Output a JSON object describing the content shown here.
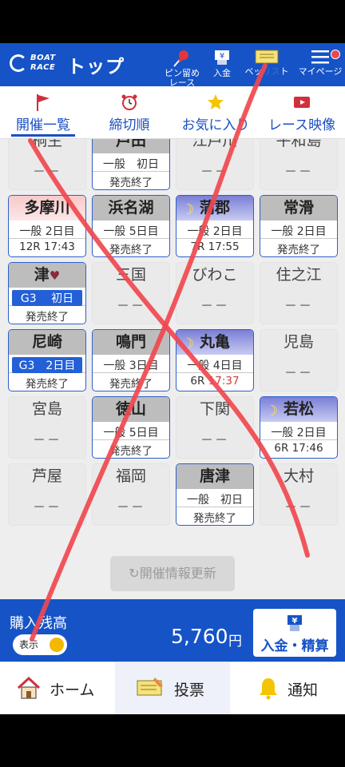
{
  "header": {
    "logo_line1": "BOAT",
    "logo_line2": "RACE",
    "title": "トップ",
    "buttons": [
      {
        "label": "ピン留め\nレース",
        "icon": "pin-icon"
      },
      {
        "label": "入金",
        "icon": "yen-deposit-icon"
      },
      {
        "label": "ベッ",
        "icon": "ticket-icon"
      },
      {
        "label": "ト",
        "icon": ""
      },
      {
        "label": "マイページ",
        "icon": "menu-icon"
      }
    ]
  },
  "tabs": [
    {
      "label": "開催一覧",
      "icon": "flag-icon",
      "active": true
    },
    {
      "label": "締切順",
      "icon": "alarm-clock-icon",
      "active": false
    },
    {
      "label": "お気に入り",
      "icon": "star-icon",
      "active": false
    },
    {
      "label": "レース映像",
      "icon": "video-icon",
      "active": false
    }
  ],
  "venues": [
    {
      "name": "桐生",
      "status": "none"
    },
    {
      "name": "戸田",
      "status": "on",
      "l2": "一般　初日",
      "l3": "発売終了"
    },
    {
      "name": "江戸川",
      "status": "none"
    },
    {
      "name": "平和島",
      "status": "none"
    },
    {
      "name": "多摩川",
      "status": "on",
      "theme": "day",
      "l2": "一般 2日目",
      "race": "12R",
      "time": "17:43"
    },
    {
      "name": "浜名湖",
      "status": "on",
      "l2": "一般 5日目",
      "l3": "発売終了"
    },
    {
      "name": "蒲郡",
      "status": "on",
      "theme": "night",
      "l2": "一般 2日目",
      "race": "7R",
      "time": "17:55"
    },
    {
      "name": "常滑",
      "status": "on",
      "l2": "一般 2日目",
      "l3": "発売終了"
    },
    {
      "name": "津",
      "status": "on",
      "heart": "♥",
      "g3": "G3　 初日",
      "l3": "発売終了"
    },
    {
      "name": "三国",
      "status": "none"
    },
    {
      "name": "びわこ",
      "status": "none"
    },
    {
      "name": "住之江",
      "status": "none"
    },
    {
      "name": "尼崎",
      "status": "on",
      "g3": "G3　2日目",
      "l3": "発売終了"
    },
    {
      "name": "鳴門",
      "status": "on",
      "l2": "一般 3日目",
      "l3": "発売終了"
    },
    {
      "name": "丸亀",
      "status": "on",
      "theme": "night",
      "l2": "一般 4日目",
      "race": "6R",
      "time": "17:37",
      "late": true
    },
    {
      "name": "児島",
      "status": "none"
    },
    {
      "name": "宮島",
      "status": "none"
    },
    {
      "name": "徳山",
      "status": "on",
      "l2": "一般 5日目",
      "l3": "発売終了"
    },
    {
      "name": "下関",
      "status": "none"
    },
    {
      "name": "若松",
      "status": "on",
      "theme": "night",
      "l2": "一般 2日目",
      "race": "6R",
      "time": "17:46"
    },
    {
      "name": "芦屋",
      "status": "none"
    },
    {
      "name": "福岡",
      "status": "none"
    },
    {
      "name": "唐津",
      "status": "on",
      "l2": "一般　初日",
      "l3": "発売終了"
    },
    {
      "name": "大村",
      "status": "none"
    }
  ],
  "none_text": "－－",
  "refresh_label": "開催情報更新",
  "balance": {
    "label": "購入残高",
    "toggle_label": "表示",
    "amount": "5,760",
    "unit": "円",
    "deposit_label": "入金・精算"
  },
  "bottom_nav": [
    {
      "label": "ホーム",
      "icon": "home-icon"
    },
    {
      "label": "投票",
      "icon": "ticket-icon"
    },
    {
      "label": "通知",
      "icon": "bell-icon"
    }
  ],
  "colors": {
    "brand": "#1553c7",
    "overlay": "#f0484e",
    "accent_yellow": "#f5b800"
  }
}
